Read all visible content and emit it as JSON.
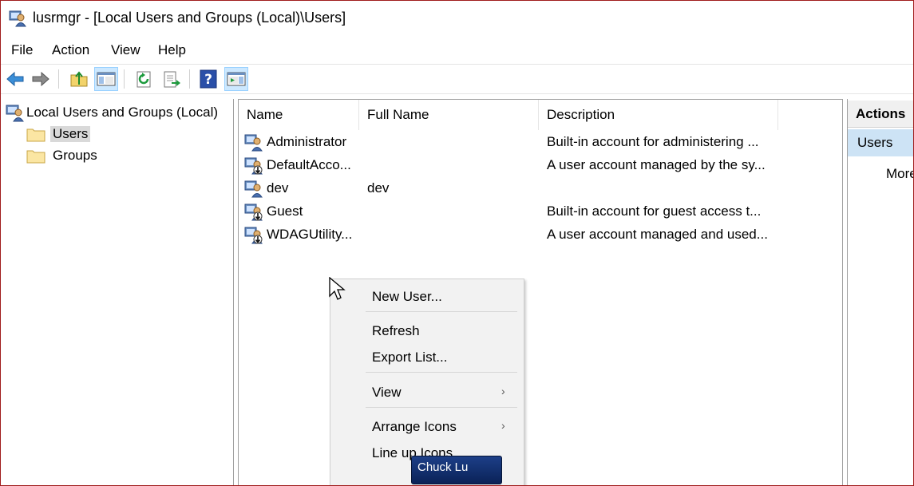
{
  "window": {
    "title": "lusrmgr - [Local Users and Groups (Local)\\Users]"
  },
  "menubar": {
    "items": [
      "File",
      "Action",
      "View",
      "Help"
    ]
  },
  "toolbar": {
    "buttons": [
      "back-icon",
      "forward-icon",
      "up-folder-icon",
      "show-hide-tree-icon",
      "refresh-icon",
      "export-list-icon",
      "help-icon",
      "show-hide-action-pane-icon"
    ]
  },
  "tree": {
    "root": "Local Users and Groups (Local)",
    "children": [
      "Users",
      "Groups"
    ],
    "selected": "Users"
  },
  "list": {
    "columns": [
      "Name",
      "Full Name",
      "Description"
    ],
    "rows": [
      {
        "name": "Administrator",
        "full_name": "",
        "description": "Built-in account for administering ..."
      },
      {
        "name": "DefaultAcco...",
        "full_name": "",
        "description": "A user account managed by the sy..."
      },
      {
        "name": "dev",
        "full_name": "dev",
        "description": ""
      },
      {
        "name": "Guest",
        "full_name": "",
        "description": "Built-in account for guest access t..."
      },
      {
        "name": "WDAGUtility...",
        "full_name": "",
        "description": "A user account managed and used..."
      }
    ]
  },
  "actions": {
    "header": "Actions",
    "section": "Users",
    "more": "More Actions"
  },
  "context_menu": {
    "items": [
      {
        "label": "New User...",
        "submenu": false
      },
      {
        "label": "Refresh",
        "submenu": false
      },
      {
        "label": "Export List...",
        "submenu": false
      },
      {
        "label": "View",
        "submenu": true
      },
      {
        "label": "Arrange Icons",
        "submenu": true
      },
      {
        "label": "Line up Icons",
        "submenu": false
      }
    ]
  },
  "taskbar_tooltip": {
    "label": "Chuck Lu"
  },
  "colors": {
    "selection": "#cde3f5",
    "window_border": "#a01c1c",
    "menu_bg": "#f2f2f2"
  }
}
